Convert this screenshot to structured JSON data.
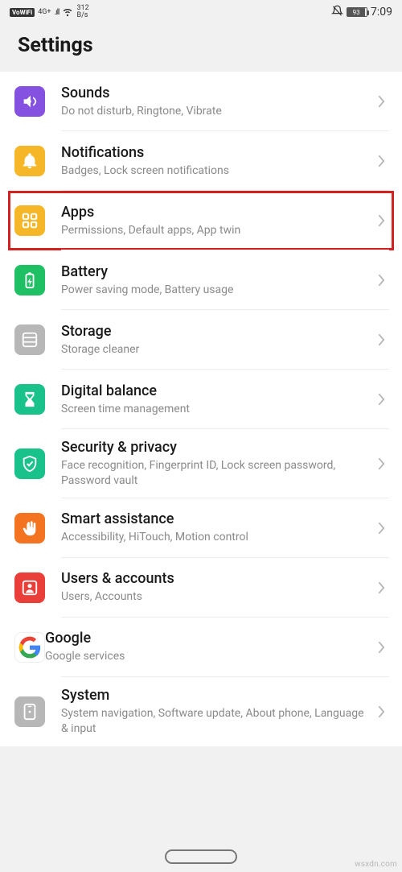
{
  "status": {
    "vowifi": "VoWiFi",
    "net_type": "4G+",
    "speed_top": "312",
    "speed_bot": "B/s",
    "battery_pct": "93",
    "time": "7:09"
  },
  "header": {
    "title": "Settings"
  },
  "items": [
    {
      "id": "sounds",
      "title": "Sounds",
      "subtitle": "Do not disturb, Ringtone, Vibrate",
      "icon": "volume-icon",
      "color": "c-purple",
      "highlight": false
    },
    {
      "id": "notifications",
      "title": "Notifications",
      "subtitle": "Badges, Lock screen notifications",
      "icon": "bell-icon",
      "color": "c-amber",
      "highlight": false
    },
    {
      "id": "apps",
      "title": "Apps",
      "subtitle": "Permissions, Default apps, App twin",
      "icon": "grid-icon",
      "color": "c-amber",
      "highlight": true
    },
    {
      "id": "battery",
      "title": "Battery",
      "subtitle": "Power saving mode, Battery usage",
      "icon": "battery-icon",
      "color": "c-green",
      "highlight": false
    },
    {
      "id": "storage",
      "title": "Storage",
      "subtitle": "Storage cleaner",
      "icon": "storage-icon",
      "color": "c-gray",
      "highlight": false
    },
    {
      "id": "digital-balance",
      "title": "Digital balance",
      "subtitle": "Screen time management",
      "icon": "hourglass-icon",
      "color": "c-teal",
      "highlight": false
    },
    {
      "id": "security",
      "title": "Security & privacy",
      "subtitle": "Face recognition, Fingerprint ID, Lock screen password, Password vault",
      "icon": "shield-icon",
      "color": "c-teal",
      "highlight": false
    },
    {
      "id": "smart-assist",
      "title": "Smart assistance",
      "subtitle": "Accessibility, HiTouch, Motion control",
      "icon": "hand-icon",
      "color": "c-orange",
      "highlight": false
    },
    {
      "id": "users",
      "title": "Users & accounts",
      "subtitle": "Users, Accounts",
      "icon": "person-icon",
      "color": "c-red",
      "highlight": false
    },
    {
      "id": "google",
      "title": "Google",
      "subtitle": "Google services",
      "icon": "google-icon",
      "color": "c-white",
      "highlight": false
    },
    {
      "id": "system",
      "title": "System",
      "subtitle": "System navigation, Software update, About phone, Language & input",
      "icon": "system-icon",
      "color": "c-gray",
      "highlight": false
    }
  ],
  "watermark": "wsxdn.com"
}
